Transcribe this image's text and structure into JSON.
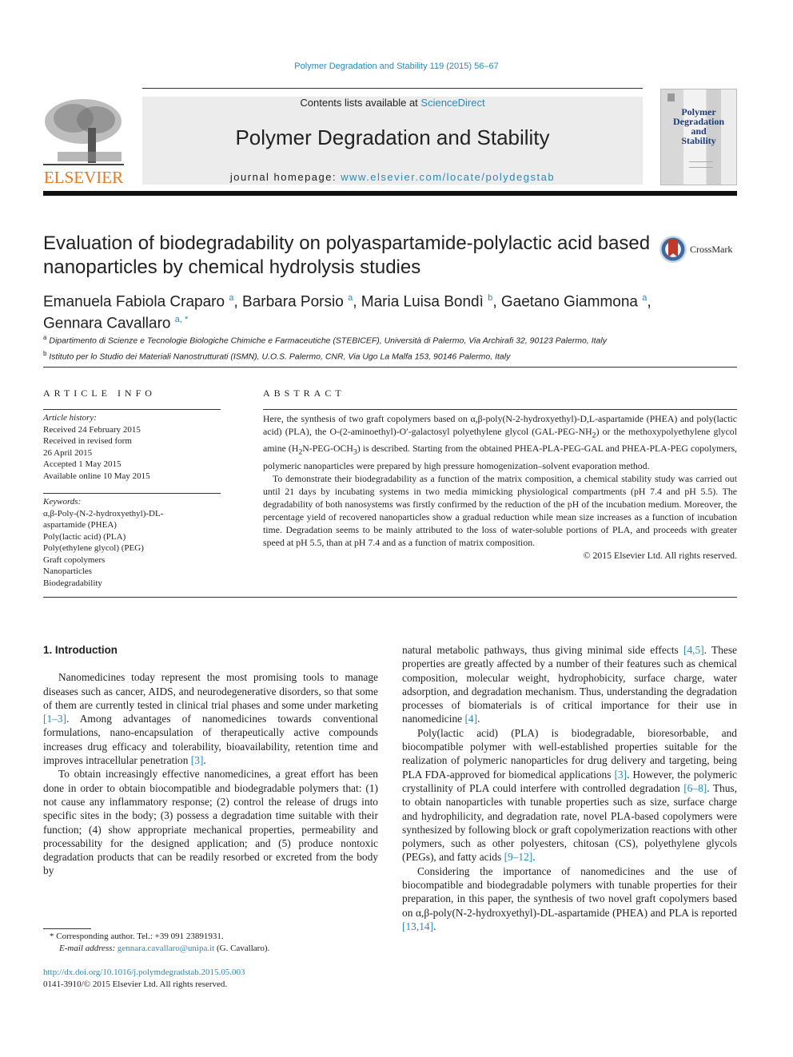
{
  "header": {
    "citation": "Polymer Degradation and Stability 119 (2015) 56–67",
    "contents_prefix": "Contents lists available at ",
    "contents_link": "ScienceDirect",
    "journal_title": "Polymer Degradation and Stability",
    "homepage_prefix": "journal homepage: ",
    "homepage_link": "www.elsevier.com/locate/polydegstab",
    "publisher_logo_text": "ELSEVIER",
    "cover_title_lines": [
      "Polymer",
      "Degradation",
      "and",
      "Stability"
    ],
    "crossmark_label": "CrossMark"
  },
  "article": {
    "title": "Evaluation of biodegradability on polyaspartamide-polylactic acid based nanoparticles by chemical hydrolysis studies",
    "authors": [
      {
        "name": "Emanuela Fabiola Craparo",
        "aff": "a",
        "sep": ", "
      },
      {
        "name": "Barbara Porsio",
        "aff": "a",
        "sep": ", "
      },
      {
        "name": "Maria Luisa Bondì",
        "aff": "b",
        "sep": ", "
      },
      {
        "name": "Gaetano Giammona",
        "aff": "a",
        "sep": ","
      },
      {
        "name": "Gennara Cavallaro",
        "aff": "a, *",
        "sep": ""
      }
    ],
    "affiliations": [
      {
        "mark": "a",
        "text": "Dipartimento di Scienze e Tecnologie Biologiche Chimiche e Farmaceutiche (STEBICEF), Università di Palermo, Via Archirafi 32, 90123 Palermo, Italy"
      },
      {
        "mark": "b",
        "text": "Istituto per lo Studio dei Materiali Nanostrutturati (ISMN), U.O.S. Palermo, CNR, Via Ugo La Malfa 153, 90146 Palermo, Italy"
      }
    ]
  },
  "article_info": {
    "heading": "ARTICLE INFO",
    "history_label": "Article history:",
    "history": [
      "Received 24 February 2015",
      "Received in revised form",
      "26 April 2015",
      "Accepted 1 May 2015",
      "Available online 10 May 2015"
    ],
    "keywords_label": "Keywords:",
    "keywords": [
      "α,β-Poly-(N-2-hydroxyethyl)-DL-",
      "aspartamide (PHEA)",
      "Poly(lactic acid) (PLA)",
      "Poly(ethylene glycol) (PEG)",
      "Graft copolymers",
      "Nanoparticles",
      "Biodegradability"
    ]
  },
  "abstract": {
    "heading": "ABSTRACT",
    "p1_a": "Here, the synthesis of two graft copolymers based on α,β-poly(N-2-hydroxyethyl)-D,L-aspartamide (PHEA) and poly(lactic acid) (PLA), the O-(2-aminoethyl)-O′-galactosyl polyethylene glycol (GAL-PEG-NH",
    "p1_sub1": "2",
    "p1_b": ") or the methoxypolyethylene glycol amine (H",
    "p1_sub2": "2",
    "p1_c": "N-PEG-OCH",
    "p1_sub3": "3",
    "p1_d": ") is described. Starting from the obtained PHEA-PLA-PEG-GAL and PHEA-PLA-PEG copolymers, polymeric nanoparticles were prepared by high pressure homogenization–solvent evaporation method.",
    "p2": "To demonstrate their biodegradability as a function of the matrix composition, a chemical stability study was carried out until 21 days by incubating systems in two media mimicking physiological compartments (pH 7.4 and pH 5.5). The degradability of both nanosystems was firstly confirmed by the reduction of the pH of the incubation medium. Moreover, the percentage yield of recovered nanoparticles show a gradual reduction while mean size increases as a function of incubation time. Degradation seems to be mainly attributed to the loss of water-soluble portions of PLA, and proceeds with greater speed at pH 5.5, than at pH 7.4 and as a function of matrix composition.",
    "copyright": "© 2015 Elsevier Ltd. All rights reserved."
  },
  "body": {
    "section_heading": "1.  Introduction",
    "left": [
      {
        "pre": "Nanomedicines today represent the most promising tools to manage diseases such as cancer, AIDS, and neurodegenerative disorders, so that some of them are currently tested in clinical trial phases and some under marketing ",
        "ref": "[1–3]",
        "post": ". Among advantages of nanomedicines towards conventional formulations, nano-encapsulation of therapeutically active compounds increases drug efficacy and tolerability, bioavailability, retention time and improves intracellular penetration ",
        "ref2": "[3]",
        "post2": "."
      },
      {
        "pre": "To obtain increasingly effective nanomedicines, a great effort has been done in order to obtain biocompatible and biodegradable polymers that: (1) not cause any inflammatory response; (2) control the release of drugs into specific sites in the body; (3) possess a degradation time suitable with their function; (4) show appropriate mechanical properties, permeability and processability for the designed application; and (5) produce nontoxic degradation products that can be readily resorbed or excreted from the body by",
        "ref": "",
        "post": "",
        "ref2": "",
        "post2": ""
      }
    ],
    "right": [
      {
        "pre": "natural metabolic pathways, thus giving minimal side effects ",
        "ref": "[4,5]",
        "post": ". These properties are greatly affected by a number of their features such as chemical composition, molecular weight, hydrophobicity, surface charge, water adsorption, and degradation mechanism. Thus, understanding the degradation processes of biomaterials is of critical importance for their use in nanomedicine ",
        "ref2": "[4]",
        "post2": "."
      },
      {
        "pre": "Poly(lactic acid) (PLA) is biodegradable, bioresorbable, and biocompatible polymer with well-established properties suitable for the realization of polymeric nanoparticles for drug delivery and targeting, being PLA FDA-approved for biomedical applications ",
        "ref": "[3]",
        "post": ". However, the polymeric crystallinity of PLA could interfere with controlled degradation ",
        "ref2": "[6–8]",
        "post2": ". Thus, to obtain nanoparticles with tunable properties such as size, surface charge and hydrophilicity, and degradation rate, novel PLA-based copolymers were synthesized by following block or graft copolymerization reactions with other polymers, such as other polyesters, chitosan (CS), polyethylene glycols (PEGs), and fatty acids ",
        "ref3": "[9–12]",
        "post3": "."
      },
      {
        "pre": "Considering the importance of nanomedicines and the use of biocompatible and biodegradable polymers with tunable properties for their preparation, in this paper, the synthesis of two novel graft copolymers based on α,β-poly(N-2-hydroxyethyl)-DL-aspartamide (PHEA) and PLA is reported ",
        "ref": "[13,14]",
        "post": "."
      }
    ]
  },
  "footnotes": {
    "corresponding": "* Corresponding author. Tel.: +39 091 23891931.",
    "email_label": "E-mail address: ",
    "email": "gennara.cavallaro@unipa.it",
    "email_suffix": " (G. Cavallaro).",
    "doi": "http://dx.doi.org/10.1016/j.polymdegradstab.2015.05.003",
    "issn": "0141-3910/© 2015 Elsevier Ltd. All rights reserved."
  }
}
